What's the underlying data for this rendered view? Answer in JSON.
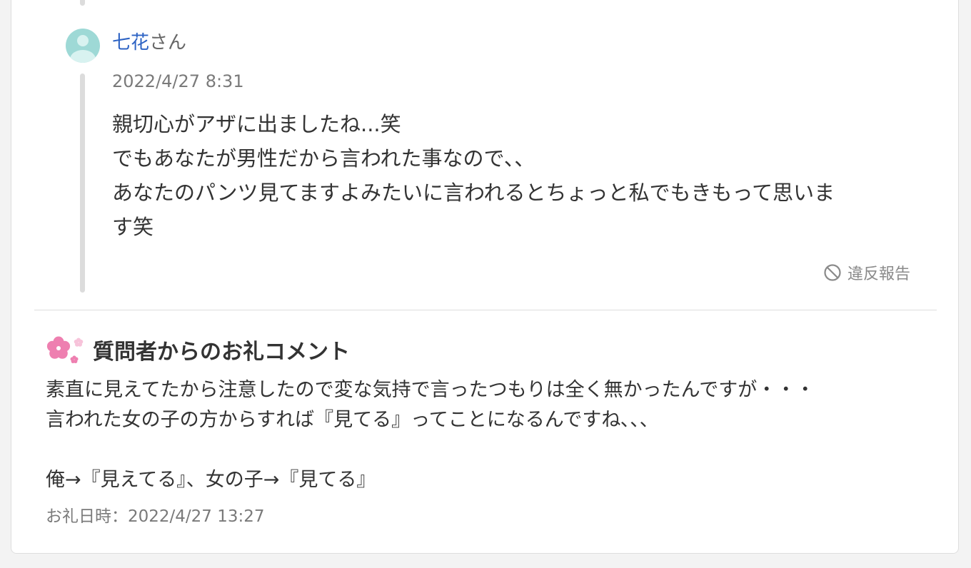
{
  "answer": {
    "username": "七花",
    "honorific": "さん",
    "timestamp": "2022/4/27 8:31",
    "lines": [
      "親切心がアザに出ましたね...笑",
      "でもあなたが男性だから言われた事なので､､",
      "あなたのパンツ見てますよみたいに言われるとちょっと私でもきもって思いま",
      "す笑"
    ],
    "report_label": "違反報告",
    "report_icon": "prohibited-icon"
  },
  "thanks": {
    "icon": "sakura-icon",
    "title": "質問者からのお礼コメント",
    "lines": [
      "素直に見えてたから注意したので変な気持で言ったつもりは全く無かったんですが・・・",
      "言われた女の子の方からすれば『見てる』ってことになるんですね､､､",
      "",
      "俺→『見えてる』、女の子→『見てる』"
    ],
    "date": "お礼日時：2022/4/27 13:27"
  },
  "colors": {
    "username": "#2d63c4",
    "avatar": "#9ed9d6",
    "text": "#333333",
    "muted": "#7a7a7a",
    "sakura": "#ee7fb0"
  }
}
